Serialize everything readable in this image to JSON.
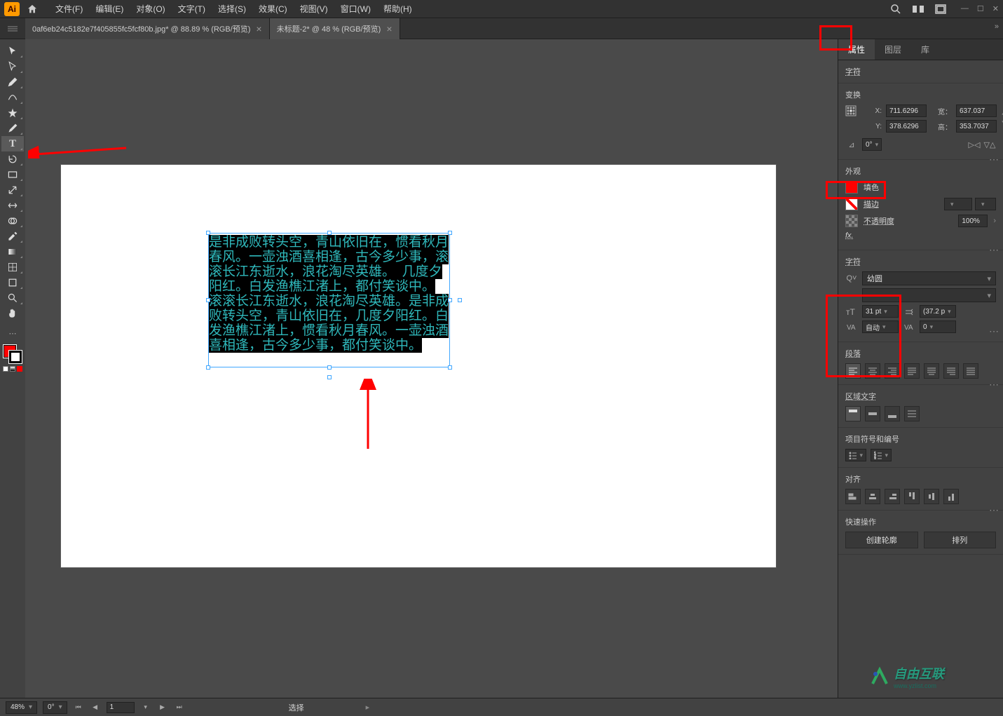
{
  "menubar": {
    "logo_text": "Ai",
    "items": [
      "文件(F)",
      "编辑(E)",
      "对象(O)",
      "文字(T)",
      "选择(S)",
      "效果(C)",
      "视图(V)",
      "窗口(W)",
      "帮助(H)"
    ]
  },
  "doc_tabs": [
    {
      "label": "0af6eb24c5182e7f405855fc5fcf80b.jpg* @ 88.89 % (RGB/预览)",
      "active": false
    },
    {
      "label": "未标题-2* @ 48 % (RGB/预览)",
      "active": true
    }
  ],
  "tools": [
    {
      "name": "selection-tool",
      "icon": "▸"
    },
    {
      "name": "direct-selection-tool",
      "icon": "▹"
    },
    {
      "name": "pen-tool",
      "icon": "✒"
    },
    {
      "name": "curvature-tool",
      "icon": "〰"
    },
    {
      "name": "star-tool",
      "icon": "✦"
    },
    {
      "name": "brush-tool",
      "icon": "/"
    },
    {
      "name": "type-tool",
      "icon": "T",
      "active": true
    },
    {
      "name": "rotate-tool",
      "icon": "↻"
    },
    {
      "name": "rect-tool",
      "icon": "▭"
    },
    {
      "name": "scale-tool",
      "icon": "⤢"
    },
    {
      "name": "width-tool",
      "icon": "⇔"
    },
    {
      "name": "shape-builder-tool",
      "icon": "◉"
    },
    {
      "name": "eyedropper-tool",
      "icon": "✎"
    },
    {
      "name": "symbol-sprayer-tool",
      "icon": "✱"
    },
    {
      "name": "gradient-tool",
      "icon": "▤"
    },
    {
      "name": "mesh-tool",
      "icon": "⊞"
    },
    {
      "name": "artboard-tool",
      "icon": "▣"
    },
    {
      "name": "zoom-tool",
      "icon": "🔍"
    },
    {
      "name": "hand-tool",
      "icon": "✋"
    }
  ],
  "canvas": {
    "text_lines": "是非成败转头空，青山依旧在，惯看秋月春风。一壶浊酒喜相逢，古今多少事，滚滚长江东逝水，浪花淘尽英雄。　几度夕阳红。白发渔樵江渚上，都付笑谈中。\n滚滚长江东逝水，浪花淘尽英雄。是非成败转头空，青山依旧在，几度夕阳红。白发渔樵江渚上，惯看秋月春风。一壶浊酒喜相逢，古今多少事，都付笑谈中。"
  },
  "right_panel": {
    "tabs": [
      "属性",
      "图层",
      "库"
    ],
    "active_tab": "属性",
    "char_title": "字符",
    "transform": {
      "title": "变换",
      "x_label": "X:",
      "x": "711.6296",
      "y_label": "Y:",
      "y": "378.6296",
      "w_label": "宽：",
      "w": "637.037",
      "h_label": "高：",
      "h": "353.7037",
      "rotate": "0°"
    },
    "appearance": {
      "title": "外观",
      "fill_label": "填色",
      "stroke_label": "描边",
      "opacity_label": "不透明度",
      "opacity": "100%",
      "fx_label": "fx."
    },
    "character": {
      "title": "字符",
      "font": "幼圆",
      "style": "-",
      "size": "31 pt",
      "leading": "(37.2 p",
      "kerning": "自动",
      "tracking": "0"
    },
    "paragraph": {
      "title": "段落"
    },
    "area_type": {
      "title": "区域文字"
    },
    "bullets": {
      "title": "项目符号和编号"
    },
    "align": {
      "title": "对齐"
    },
    "quick": {
      "title": "快速操作",
      "btn1": "创建轮廓",
      "btn2": "排列"
    }
  },
  "statusbar": {
    "zoom": "48%",
    "rotate": "0°",
    "page": "1",
    "selection": "选择"
  },
  "watermark": {
    "brand": "自由互联",
    "sub": "www.yzlist.com"
  }
}
